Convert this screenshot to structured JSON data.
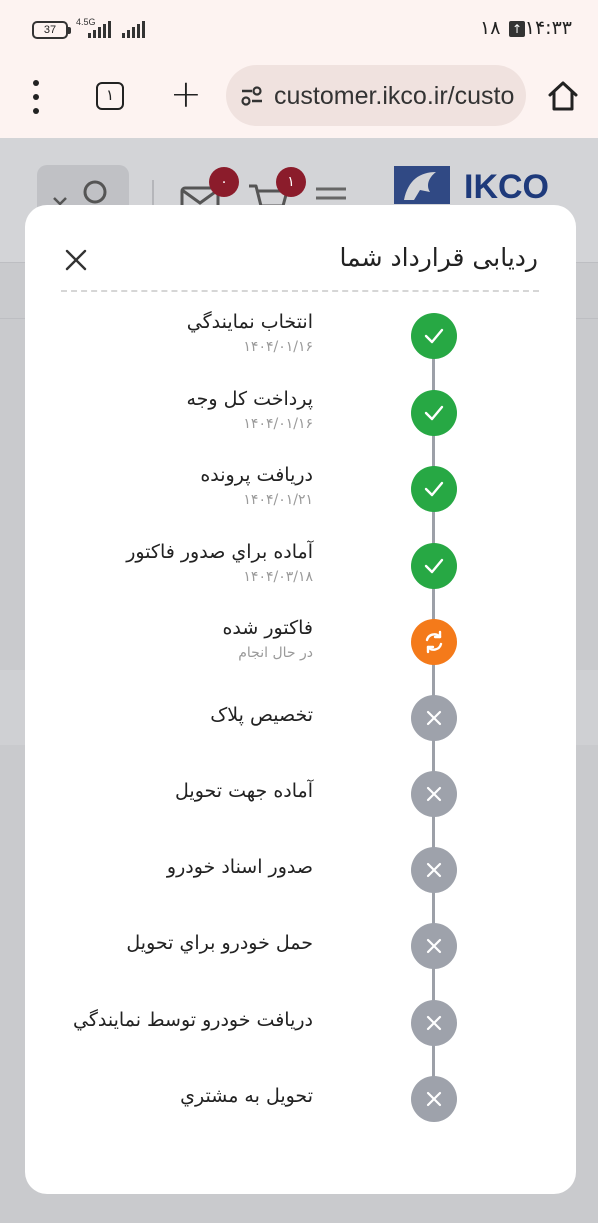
{
  "status_bar": {
    "battery": "37",
    "network": "4.5G",
    "notification": "۱۸",
    "time": "۱۴:۳۳"
  },
  "browser": {
    "tab_count": "۱",
    "url": "customer.ikco.ir/custo"
  },
  "background_page": {
    "logo_text": "IKCO",
    "messages_badge": "۰",
    "cart_badge": "۱"
  },
  "modal": {
    "title": "ردیابی قرارداد شما",
    "steps": [
      {
        "label": "انتخاب نمايندگي",
        "sub": "۱۴۰۴/۰۱/۱۶",
        "status": "done"
      },
      {
        "label": "پرداخت کل وجه",
        "sub": "۱۴۰۴/۰۱/۱۶",
        "status": "done"
      },
      {
        "label": "دريافت پرونده",
        "sub": "۱۴۰۴/۰۱/۲۱",
        "status": "done"
      },
      {
        "label": "آماده براي صدور فاكتور",
        "sub": "۱۴۰۴/۰۳/۱۸",
        "status": "done"
      },
      {
        "label": "فاکتور شده",
        "sub": "در حال انجام",
        "status": "in-progress"
      },
      {
        "label": "تخصيص پلاک",
        "sub": "",
        "status": "pending"
      },
      {
        "label": "آماده جهت تحويل",
        "sub": "",
        "status": "pending"
      },
      {
        "label": "صدور اسناد خودرو",
        "sub": "",
        "status": "pending"
      },
      {
        "label": "حمل خودرو براي تحويل",
        "sub": "",
        "status": "pending"
      },
      {
        "label": "دريافت خودرو توسط نمايندگي",
        "sub": "",
        "status": "pending"
      },
      {
        "label": "تحويل به مشتري",
        "sub": "",
        "status": "pending"
      }
    ]
  },
  "colors": {
    "done": "#27a844",
    "in_progress": "#f47a1a",
    "pending": "#9ea2ab",
    "badge": "#8b1c2b",
    "logo": "#1e3a7b"
  }
}
